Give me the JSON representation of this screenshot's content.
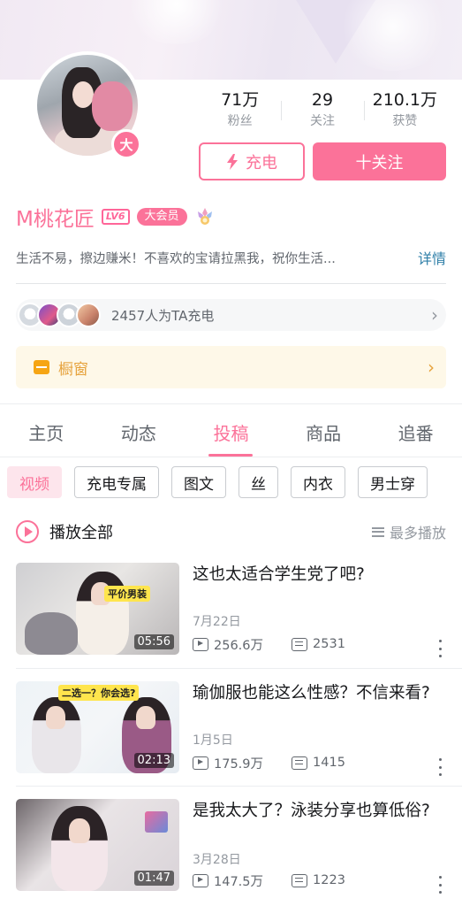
{
  "profile": {
    "avatar_badge": "大",
    "username": "M桃花匠",
    "level": "LV6",
    "vip_label": "大会员",
    "sign": "生活不易，擦边赚米！不喜欢的宝请拉黑我，祝你生活...",
    "sign_more": "详情"
  },
  "stats": [
    {
      "value": "71万",
      "label": "粉丝"
    },
    {
      "value": "29",
      "label": "关注"
    },
    {
      "value": "210.1万",
      "label": "获赞"
    }
  ],
  "actions": {
    "charge_label": "充电",
    "follow_label": "十关注"
  },
  "chargers": {
    "text": "2457人为TA充电"
  },
  "shop": {
    "label": "橱窗"
  },
  "tabs": [
    {
      "label": "主页"
    },
    {
      "label": "动态"
    },
    {
      "label": "投稿",
      "active": true
    },
    {
      "label": "商品"
    },
    {
      "label": "追番"
    }
  ],
  "filters": [
    {
      "label": "视频",
      "active": true
    },
    {
      "label": "充电专属"
    },
    {
      "label": "图文"
    },
    {
      "label": "丝"
    },
    {
      "label": "内衣"
    },
    {
      "label": "男士穿"
    }
  ],
  "playlist": {
    "play_all": "播放全部",
    "sort": "最多播放"
  },
  "videos": [
    {
      "title": "这也太适合学生党了吧?",
      "date": "7月22日",
      "views": "256.6万",
      "danmaku": "2531",
      "duration": "05:56",
      "thumb_tag": "平价男装"
    },
    {
      "title": "瑜伽服也能这么性感？不信来看?",
      "date": "1月5日",
      "views": "175.9万",
      "danmaku": "1415",
      "duration": "02:13",
      "thumb_tag": "二选一？你会选?"
    },
    {
      "title": "是我太大了？泳装分享也算低俗?",
      "date": "3月28日",
      "views": "147.5万",
      "danmaku": "1223",
      "duration": "01:47",
      "thumb_tag": ""
    }
  ],
  "colors": {
    "accent": "#fb7299",
    "link": "#2f7fa8",
    "shop": "#e6a23c"
  }
}
